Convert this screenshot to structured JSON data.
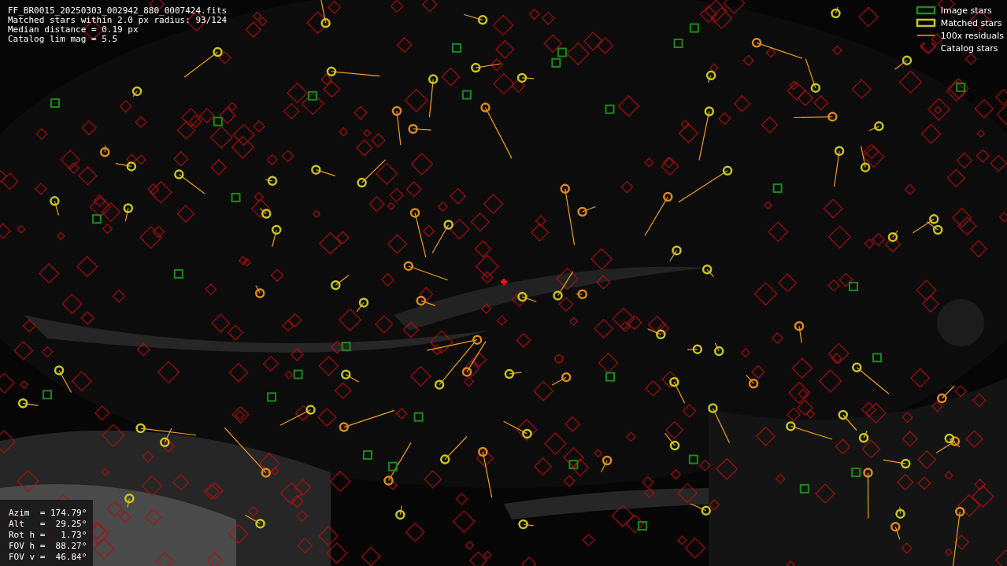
{
  "header_lines": [
    "FF_BR0015_20250303_002942_880_0007424.fits",
    "Matched stars within 2.0 px radius: 93/124",
    "Median distance = 0.19 px",
    "Catalog lim mag = 5.5"
  ],
  "legend": [
    {
      "label": "Image stars"
    },
    {
      "kind": "matched",
      "label": "Matched stars"
    },
    {
      "kind": "residual",
      "label": "100x residuals"
    },
    {
      "kind": "catalog",
      "label": "Catalog stars"
    }
  ],
  "pointing": [
    "Azim  = 174.79°",
    "Alt   =  29.25°",
    "Rot h =   1.73°",
    "FOV h =  88.27°",
    "FOV v =  46.84°"
  ]
}
